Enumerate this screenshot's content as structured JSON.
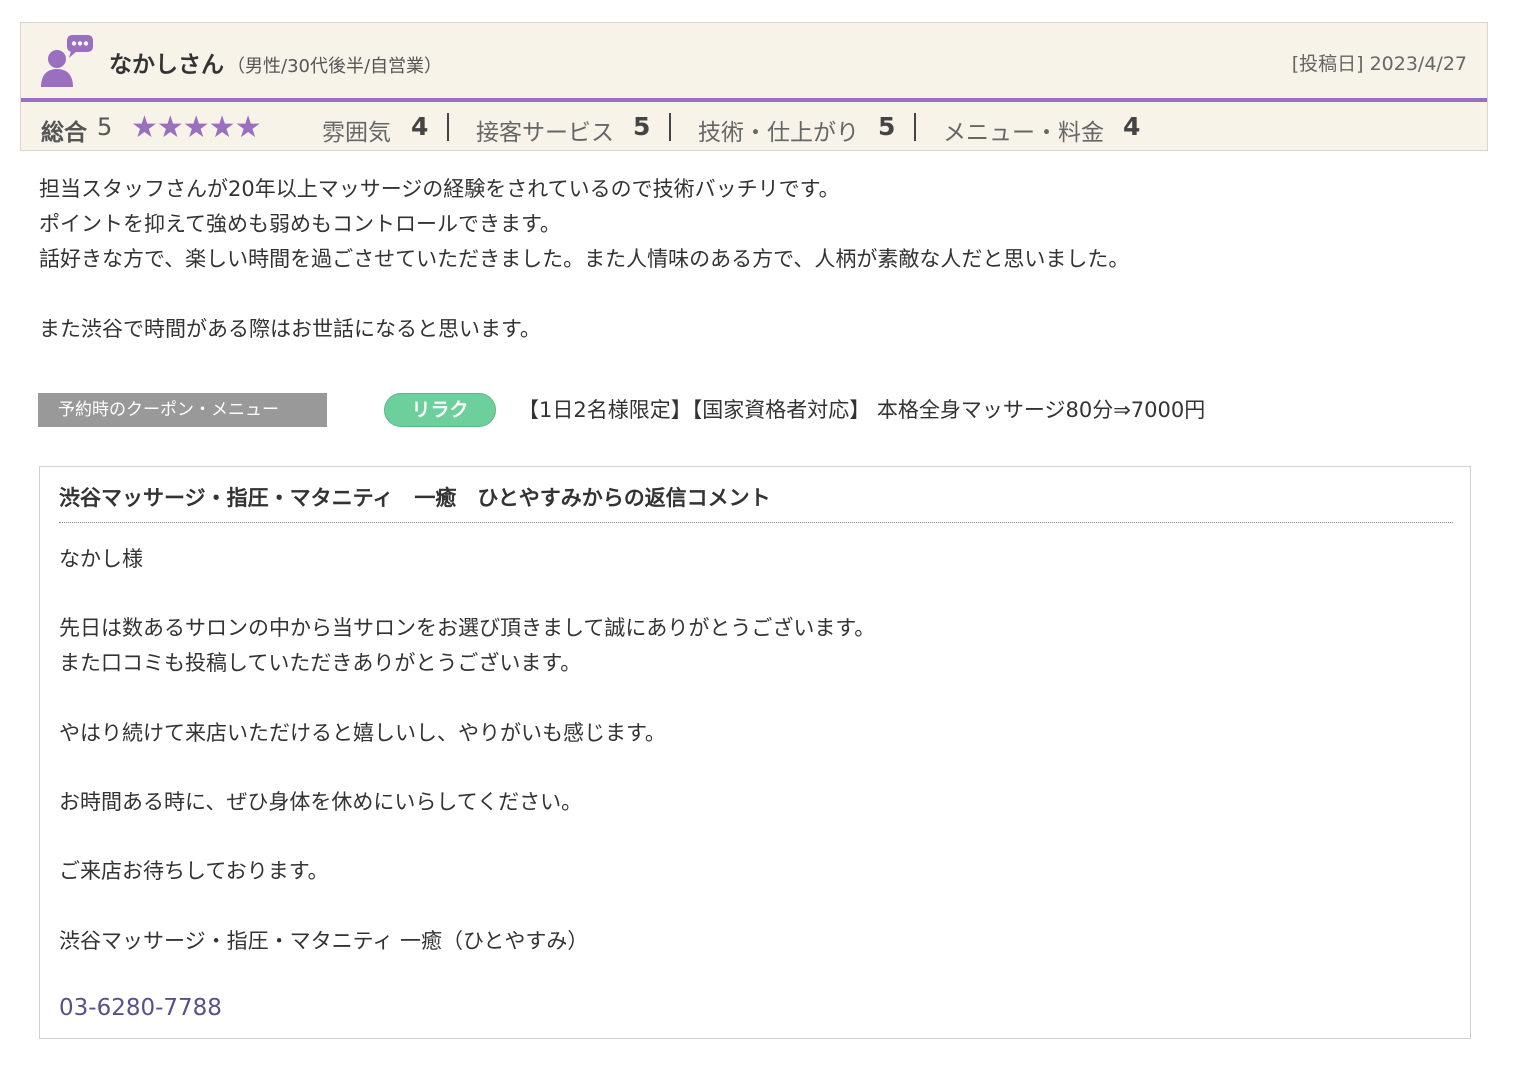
{
  "reviewer": {
    "name": "なかしさん",
    "meta": "（男性/30代後半/自営業）",
    "post_date": "[投稿日] 2023/4/27"
  },
  "ratings": {
    "overall_label": "総合",
    "overall_score": "5",
    "stars_filled": 5,
    "stars_text": "★★★★★",
    "categories": [
      {
        "label": "雰囲気",
        "score": "4"
      },
      {
        "label": "接客サービス",
        "score": "5"
      },
      {
        "label": "技術・仕上がり",
        "score": "5"
      },
      {
        "label": "メニュー・料金",
        "score": "4"
      }
    ]
  },
  "review_text": "担当スタッフさんが20年以上マッサージの経験をされているので技術バッチリです。\nポイントを抑えて強めも弱めもコントロールできます。\n話好きな方で、楽しい時間を過ごさせていただきました。また人情味のある方で、人柄が素敵な人だと思いました。\n\nまた渋谷で時間がある際はお世話になると思います。",
  "coupon": {
    "label": "予約時のクーポン・メニュー",
    "badge": "リラク",
    "text": "【1日2名様限定】【国家資格者対応】 本格全身マッサージ80分⇒7000円"
  },
  "reply": {
    "title": "渋谷マッサージ・指圧・マタニティ　一癒　ひとやすみからの返信コメント",
    "body": "なかし様\n\n先日は数あるサロンの中から当サロンをお選び頂きまして誠にありがとうございます。\nまた口コミも投稿していただきありがとうございます。\n\nやはり続けて来店いただけると嬉しいし、やりがいも感じます。\n\nお時間ある時に、ぜひ身体を休めにいらしてください。\n\nご来店お待ちしております。\n\n渋谷マッサージ・指圧・マタニティ 一癒（ひとやすみ）",
    "phone": "03-6280-7788"
  },
  "colors": {
    "accent": "#9b6fc0",
    "header_bg": "#f7f3e9",
    "badge_green": "#6dcf9c",
    "label_gray": "#999999",
    "phone_link": "#5a4f8a"
  },
  "icons": {
    "avatar": "user-comment-icon",
    "star": "star-icon"
  }
}
